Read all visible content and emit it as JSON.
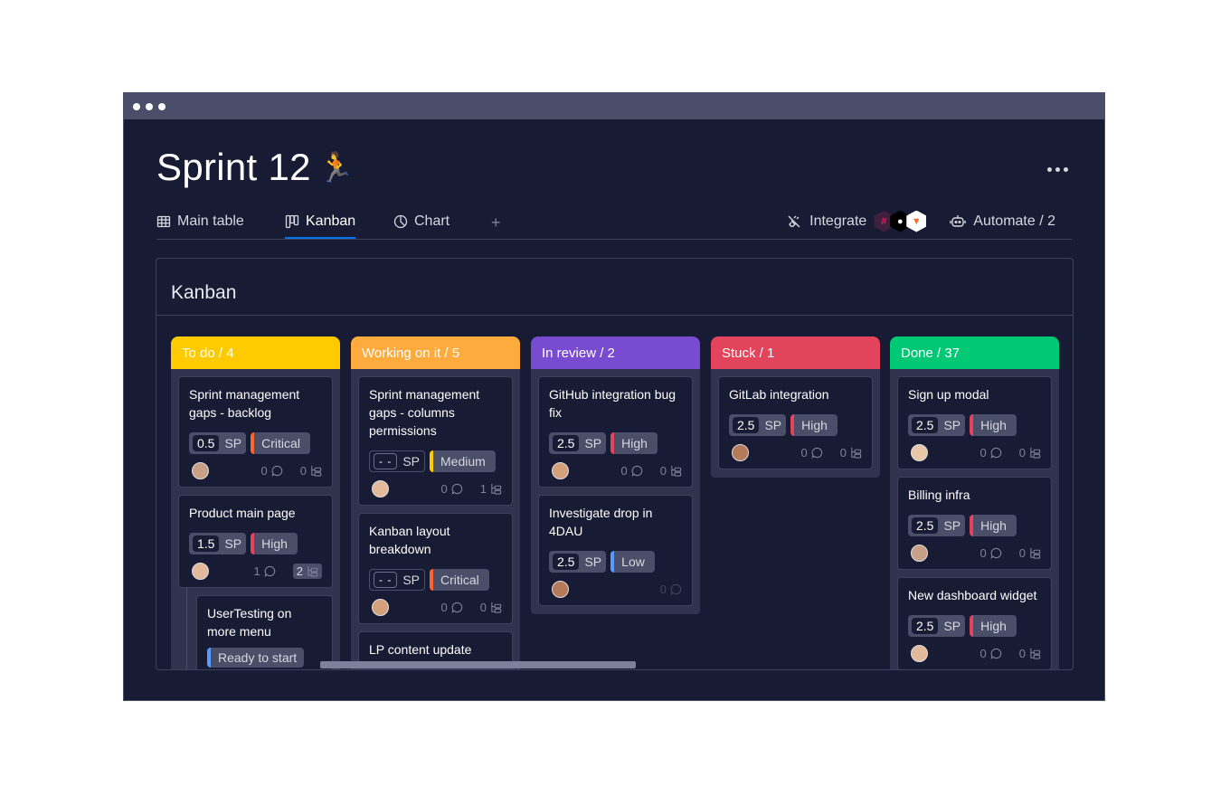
{
  "window": {
    "title": "Sprint 12",
    "title_emoji": "🏃"
  },
  "tabs": [
    {
      "label": "Main table",
      "icon": "table-icon",
      "active": false
    },
    {
      "label": "Kanban",
      "icon": "kanban-icon",
      "active": true
    },
    {
      "label": "Chart",
      "icon": "chart-icon",
      "active": false
    }
  ],
  "add_tab_label": "+",
  "toolbar": {
    "integrate_label": "Integrate",
    "integrations": [
      "slack",
      "github",
      "gitlab"
    ],
    "automate_label": "Automate / 2"
  },
  "panel": {
    "title": "Kanban"
  },
  "colors": {
    "todo": "#ffcb00",
    "working": "#fdab3d",
    "review": "#784bd1",
    "stuck": "#e2445c",
    "done": "#00c875",
    "critical": "#ff642e",
    "high": "#e2445c",
    "medium": "#ffcb00",
    "low": "#579bfc"
  },
  "columns": [
    {
      "header": "To do / 4",
      "color": "#ffcb00",
      "cards": [
        {
          "title": "Sprint management gaps - backlog",
          "sp": "0.5",
          "priority": "Critical",
          "priority_color": "#ff642e",
          "comments": "0",
          "subitems": "0"
        },
        {
          "title": "Product main page",
          "sp": "1.5",
          "priority": "High",
          "priority_color": "#e2445c",
          "comments": "1",
          "subitems": "2"
        }
      ],
      "subitem": {
        "title": "UserTesting on more menu",
        "status": "Ready to start"
      }
    },
    {
      "header": "Working on it / 5",
      "color": "#fdab3d",
      "cards": [
        {
          "title": "Sprint management gaps - columns permissions",
          "sp": "- -",
          "priority": "Medium",
          "priority_color": "#ffcb00",
          "comments": "0",
          "subitems": "1"
        },
        {
          "title": "Kanban layout breakdown",
          "sp": "- -",
          "priority": "Critical",
          "priority_color": "#ff642e",
          "comments": "0",
          "subitems": "0"
        },
        {
          "title": "LP content update"
        }
      ]
    },
    {
      "header": "In review / 2",
      "color": "#784bd1",
      "cards": [
        {
          "title": "GitHub integration bug fix",
          "sp": "2.5",
          "priority": "High",
          "priority_color": "#e2445c",
          "comments": "0",
          "subitems": "0"
        },
        {
          "title": "Investigate drop in 4DAU",
          "sp": "2.5",
          "priority": "Low",
          "priority_color": "#579bfc",
          "comments": "0"
        }
      ]
    },
    {
      "header": "Stuck / 1",
      "color": "#e2445c",
      "cards": [
        {
          "title": "GitLab integration",
          "sp": "2.5",
          "priority": "High",
          "priority_color": "#e2445c",
          "comments": "0",
          "subitems": "0"
        }
      ]
    },
    {
      "header": "Done  / 37",
      "color": "#00c875",
      "cards": [
        {
          "title": "Sign up modal",
          "sp": "2.5",
          "priority": "High",
          "priority_color": "#e2445c",
          "comments": "0",
          "subitems": "0"
        },
        {
          "title": "Billing infra",
          "sp": "2.5",
          "priority": "High",
          "priority_color": "#e2445c",
          "comments": "0",
          "subitems": "0"
        },
        {
          "title": "New dashboard widget",
          "sp": "2.5",
          "priority": "High",
          "priority_color": "#e2445c",
          "comments": "0",
          "subitems": "0"
        }
      ]
    }
  ]
}
